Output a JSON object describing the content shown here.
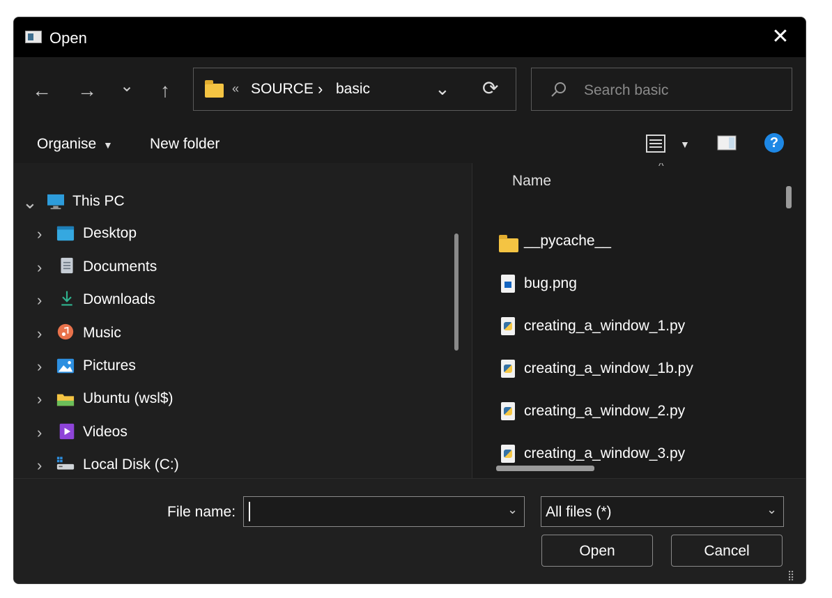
{
  "window": {
    "title": "Open",
    "close_glyph": "✕"
  },
  "nav": {
    "back_glyph": "←",
    "forward_glyph": "→",
    "recent_glyph": "⌄",
    "up_glyph": "↑",
    "breadcrumb": {
      "overflow": "«",
      "items": [
        "SOURCE",
        "basic"
      ],
      "separator": "›"
    },
    "dropdown_glyph": "⌄",
    "refresh_glyph": "⟳"
  },
  "search": {
    "placeholder": "Search basic"
  },
  "toolbar": {
    "organise": "Organise",
    "new_folder": "New folder",
    "help_glyph": "?"
  },
  "tree": {
    "root": "This PC",
    "items": [
      {
        "label": "Desktop",
        "icon": "desktop-icon"
      },
      {
        "label": "Documents",
        "icon": "documents-icon"
      },
      {
        "label": "Downloads",
        "icon": "downloads-icon"
      },
      {
        "label": "Music",
        "icon": "music-icon"
      },
      {
        "label": "Pictures",
        "icon": "pictures-icon"
      },
      {
        "label": "Ubuntu (wsl$)",
        "icon": "folder-icon"
      },
      {
        "label": "Videos",
        "icon": "videos-icon"
      },
      {
        "label": "Local Disk (C:)",
        "icon": "drive-icon"
      }
    ]
  },
  "files": {
    "column_name": "Name",
    "items": [
      {
        "name": "__pycache__",
        "type": "folder"
      },
      {
        "name": "bug.png",
        "type": "png"
      },
      {
        "name": "creating_a_window_1.py",
        "type": "py"
      },
      {
        "name": "creating_a_window_1b.py",
        "type": "py"
      },
      {
        "name": "creating_a_window_2.py",
        "type": "py"
      },
      {
        "name": "creating_a_window_3.py",
        "type": "py"
      }
    ]
  },
  "bottom": {
    "file_name_label": "File name:",
    "file_name_value": "",
    "filter": "All files (*)",
    "open": "Open",
    "cancel": "Cancel"
  },
  "colors": {
    "accent": "#1e88e5",
    "folder": "#f4c443",
    "background": "#1f1f1f"
  }
}
